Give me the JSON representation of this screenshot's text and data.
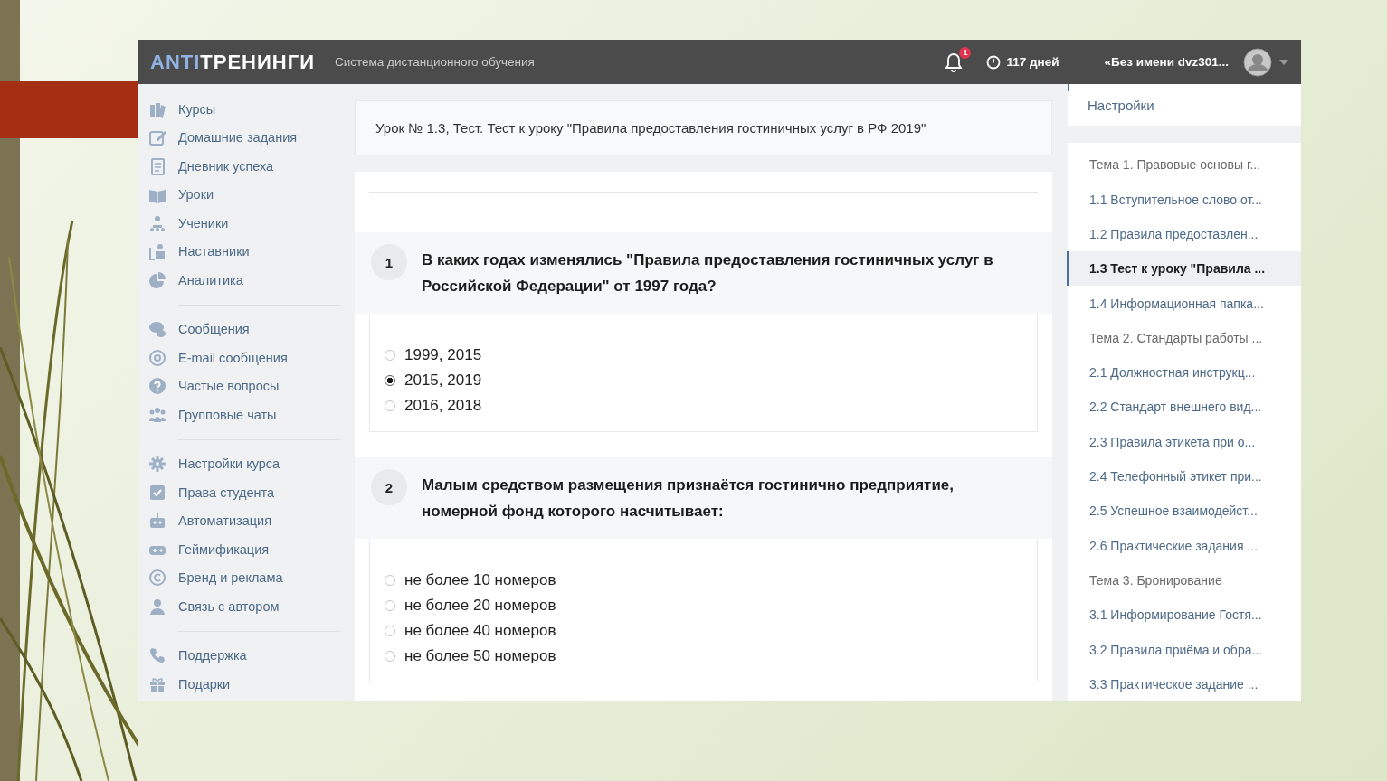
{
  "header": {
    "logo_accent": "ANTI",
    "logo_text": "ТРЕНИНГИ",
    "subtitle": "Система дистанционного обучения",
    "notifications": "1",
    "days": "117 дней",
    "user": "«Без имени dvz301..."
  },
  "sidebar": {
    "groups": [
      [
        "Курсы",
        "Домашние задания",
        "Дневник успеха",
        "Уроки",
        "Ученики",
        "Наставники",
        "Аналитика"
      ],
      [
        "Сообщения",
        "E-mail сообщения",
        "Частые вопросы",
        "Групповые чаты"
      ],
      [
        "Настройки курса",
        "Права студента",
        "Автоматизация",
        "Геймификация",
        "Бренд и реклама",
        "Связь с автором"
      ],
      [
        "Поддержка",
        "Подарки"
      ]
    ]
  },
  "lesson_title": "Урок № 1.3, Тест. Тест к уроку \"Правила предоставления гостиничных услуг в РФ 2019\"",
  "questions": [
    {
      "number": "1",
      "text": "В каких годах изменялись \"Правила предоставления гостиничных услуг в Российской Федерации\" от 1997 года?",
      "options": [
        {
          "label": "1999, 2015",
          "selected": false
        },
        {
          "label": "2015, 2019",
          "selected": true
        },
        {
          "label": "2016, 2018",
          "selected": false
        }
      ]
    },
    {
      "number": "2",
      "text": "Малым средством размещения признаётся гостинично предприятие, номерной фонд которого насчитывает:",
      "options": [
        {
          "label": "не более 10 номеров",
          "selected": false
        },
        {
          "label": "не более 20 номеров",
          "selected": false
        },
        {
          "label": "не более 40 номеров",
          "selected": false
        },
        {
          "label": "не более 50 номеров",
          "selected": false
        }
      ]
    }
  ],
  "right_panel": {
    "settings": "Настройки",
    "lessons": [
      {
        "label": "Тема 1. Правовые основы г...",
        "kind": "topic",
        "selected": false
      },
      {
        "label": "1.1 Вступительное слово от...",
        "kind": "lesson",
        "selected": false
      },
      {
        "label": "1.2 Правила предоставлен...",
        "kind": "lesson",
        "selected": false
      },
      {
        "label": "1.3 Тест к уроку \"Правила ...",
        "kind": "lesson",
        "selected": true
      },
      {
        "label": "1.4 Информационная папка...",
        "kind": "lesson",
        "selected": false
      },
      {
        "label": "Тема 2. Стандарты работы ...",
        "kind": "topic",
        "selected": false
      },
      {
        "label": "2.1 Должностная инструкц...",
        "kind": "lesson",
        "selected": false
      },
      {
        "label": "2.2 Стандарт внешнего вид...",
        "kind": "lesson",
        "selected": false
      },
      {
        "label": "2.3 Правила этикета при о...",
        "kind": "lesson",
        "selected": false
      },
      {
        "label": "2.4 Телефонный этикет при...",
        "kind": "lesson",
        "selected": false
      },
      {
        "label": "2.5 Успешное взаимодейст...",
        "kind": "lesson",
        "selected": false
      },
      {
        "label": "2.6 Практические задания ...",
        "kind": "lesson",
        "selected": false
      },
      {
        "label": "Тема 3. Бронирование",
        "kind": "topic",
        "selected": false
      },
      {
        "label": "3.1 Информирование Гостя...",
        "kind": "lesson",
        "selected": false
      },
      {
        "label": "3.2 Правила приёма и обра...",
        "kind": "lesson",
        "selected": false
      },
      {
        "label": "3.3 Практическое задание ...",
        "kind": "lesson",
        "selected": false
      }
    ]
  }
}
